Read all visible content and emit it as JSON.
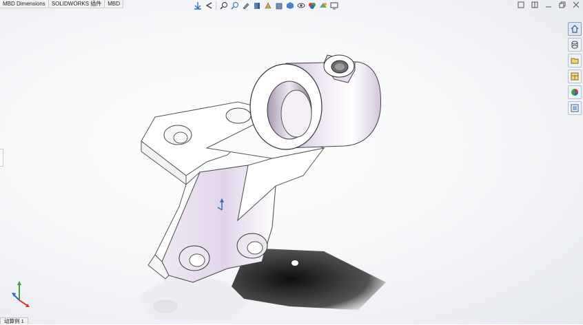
{
  "command_manager": {
    "tabs": [
      "MBD Dimensions",
      "SOLIDWORKS 插件",
      "MBD"
    ]
  },
  "heads_up_toolbar": {
    "icons": [
      "zoom-to-fit-icon",
      "zoom-to-area-icon",
      "previous-view-icon",
      "section-view-icon",
      "dynamic-annotation-icon",
      "view-orientation-icon",
      "display-style-icon",
      "hide-show-items-icon",
      "edit-appearance-icon",
      "apply-scene-icon",
      "view-settings-icon"
    ]
  },
  "task_pane": {
    "icons": [
      "home-icon",
      "parts-library-icon",
      "file-explorer-icon",
      "view-palette-icon",
      "appearances-icon",
      "custom-properties-icon"
    ]
  },
  "bottom_tabs": {
    "items": [
      "动算例 1"
    ]
  },
  "colors": {
    "accent": "#2f6db3",
    "part_face": "#d9d0e0",
    "part_light": "#ffffff",
    "shadow": "#1c1c1c"
  }
}
